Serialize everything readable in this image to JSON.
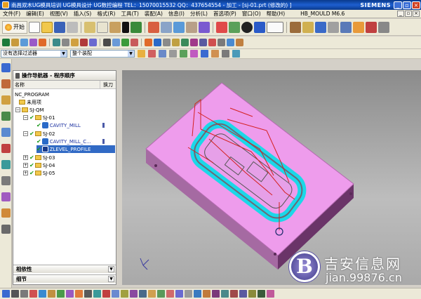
{
  "window": {
    "title": "南昌双木UG模具培训  UG模具设计  UG数控编程  TEL：15070015532  QQ：437654554 - 加工 - [sj-01.prt  (修改的) ]",
    "brand": "SIEMENS"
  },
  "menu": {
    "start_label": "开始",
    "items": [
      "文件(F)",
      "编辑(E)",
      "视图(V)",
      "插入(S)",
      "格式(R)",
      "工具(T)",
      "装配(A)",
      "信息(I)",
      "分析(L)",
      "首选项(P)",
      "窗口(O)",
      "帮助(H)"
    ],
    "app_tag": "HB_MOULD M6.6"
  },
  "filters": {
    "selection_filter": "没有选择过滤器",
    "assembly_scope": "整个装配"
  },
  "navigator": {
    "title": "操作导航器 - 程序顺序",
    "col_name": "名称",
    "col_tool": "换刀",
    "rows": [
      {
        "label": "NC_PROGRAM",
        "kind": "root"
      },
      {
        "label": "未用项",
        "kind": "folder"
      },
      {
        "label": "SJ-QM",
        "kind": "program"
      },
      {
        "label": "SJ-01",
        "kind": "program"
      },
      {
        "label": "CAVITY_MILL",
        "kind": "operation"
      },
      {
        "label": "SJ-02",
        "kind": "program"
      },
      {
        "label": "CAVITY_MILL_C...",
        "kind": "operation"
      },
      {
        "label": "ZLEVEL_PROFILE",
        "kind": "operation",
        "selected": true
      },
      {
        "label": "SJ-03",
        "kind": "program"
      },
      {
        "label": "SJ-04",
        "kind": "program"
      },
      {
        "label": "SJ-05",
        "kind": "program"
      }
    ],
    "footer_dependencies": "相依性",
    "footer_details": "细节"
  },
  "watermark": {
    "logo_letter": "B",
    "name": "吉安信息网",
    "url": "jian.99876.cn"
  },
  "colors": {
    "titlebar": "#0a3a8c",
    "part_top": "#ee9cec",
    "part_side": "#7a3c78",
    "toolpath_cyan": "#1bd8e8",
    "toolpath_red": "#d42020",
    "selection": "#316ac5"
  }
}
